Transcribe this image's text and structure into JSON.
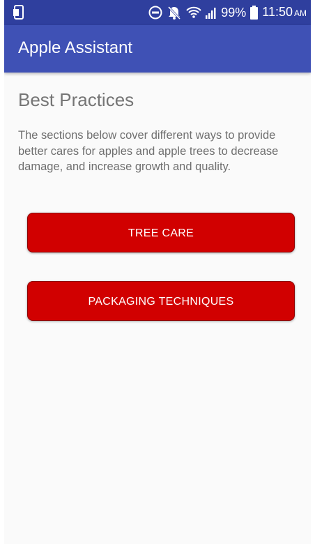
{
  "status_bar": {
    "battery_percent": "99%",
    "time": "11:50",
    "ampm": "AM",
    "icons": [
      "screenshot-icon",
      "do-not-disturb-icon",
      "notifications-off-icon",
      "wifi-icon",
      "signal-icon",
      "battery-icon"
    ]
  },
  "app_bar": {
    "title": "Apple Assistant"
  },
  "content": {
    "heading": "Best Practices",
    "description": "The sections below cover different ways to provide better cares for apples and apple trees to decrease damage, and increase growth and quality.",
    "buttons": [
      {
        "label": "TREE CARE"
      },
      {
        "label": "PACKAGING TECHNIQUES"
      }
    ]
  },
  "colors": {
    "status_bar": "#2f3f9e",
    "app_bar": "#3f51b5",
    "button": "#d10000",
    "background": "#fafafa",
    "heading_text": "#757575"
  }
}
